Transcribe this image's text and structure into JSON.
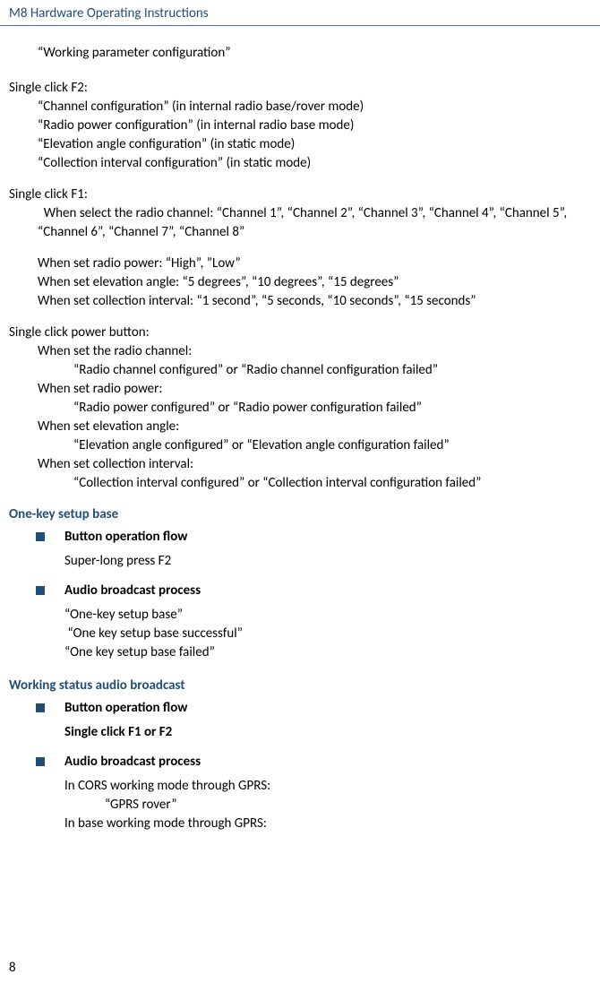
{
  "header": "M8 Hardware Operating Instructions",
  "top_line": "“Working parameter configuration”",
  "f2": {
    "title": "Single click F2:",
    "lines": [
      "“Channel configuration” (in internal radio base/rover mode)",
      "“Radio power configuration” (in internal radio base mode)",
      "“Elevation angle configuration” (in static mode)",
      "“Collection interval configuration” (in static mode)"
    ]
  },
  "f1": {
    "title": "Single click F1:",
    "channel_line": "  When select the radio channel: “Channel 1”, “Channel 2”, “Channel 3”, “Channel 4”, “Channel 5”, “Channel 6”, “Channel 7”, “Channel 8”",
    "lines": [
      "When set radio power: “High”, ”Low”",
      "When set elevation angle: “5 degrees”, “10 degrees”, “15 degrees”",
      "When set collection interval: “1 second”, “5 seconds, “10 seconds”, “15 seconds”"
    ]
  },
  "power": {
    "title": "Single click power button:",
    "groups": [
      {
        "label": "When set the radio channel:",
        "result": "“Radio channel configured” or “Radio channel configuration failed”"
      },
      {
        "label": "When set radio power:",
        "result": "“Radio power configured” or “Radio power configuration failed”"
      },
      {
        "label": "When set elevation angle:",
        "result": "“Elevation angle configured” or “Elevation angle configuration failed”"
      },
      {
        "label": "When set collection interval:",
        "result": "“Collection interval configured” or “Collection interval configuration failed”"
      }
    ]
  },
  "one_key": {
    "title": "One-key setup base",
    "bullet1": "Button operation flow",
    "bullet1_body": "Super-long press F2",
    "bullet2": "Audio broadcast process",
    "bullet2_lines": [
      "“One-key setup base”",
      " “One key setup base successful”",
      "“One key setup base failed”"
    ]
  },
  "working_status": {
    "title": "Working status audio broadcast",
    "bullet1": "Button operation flow",
    "bullet1_body": "Single click F1 or F2",
    "bullet2": "Audio broadcast process",
    "bullet2_lines": [
      "In CORS working mode through GPRS:",
      "   “GPRS rover”",
      "In base working mode through GPRS:"
    ]
  },
  "page_number": "8"
}
